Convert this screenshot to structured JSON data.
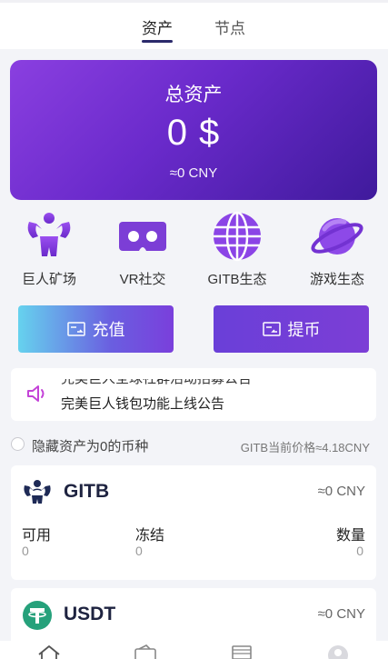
{
  "tabs": [
    {
      "label": "资产",
      "active": true
    },
    {
      "label": "节点",
      "active": false
    }
  ],
  "hero": {
    "title": "总资产",
    "amount": "0 $",
    "cny": "≈0 CNY"
  },
  "features": [
    {
      "label": "巨人矿场",
      "icon": "muscle-giant-icon"
    },
    {
      "label": "VR社交",
      "icon": "vr-headset-icon"
    },
    {
      "label": "GITB生态",
      "icon": "globe-icon"
    },
    {
      "label": "游戏生态",
      "icon": "planet-icon"
    }
  ],
  "actions": {
    "deposit": "充值",
    "withdraw": "提币"
  },
  "notice": {
    "previous": "完美巨人全球社群活动招募公告",
    "current": "完美巨人钱包功能上线公告"
  },
  "filter": {
    "hide_zero_label": "隐藏资产为0的币种",
    "price_text": "GITB当前价格≈4.18CNY"
  },
  "assets": [
    {
      "name": "GITB",
      "cny": "≈0 CNY",
      "columns": [
        {
          "label": "可用",
          "value": "0"
        },
        {
          "label": "冻结",
          "value": "0"
        },
        {
          "label": "数量",
          "value": "0"
        }
      ]
    },
    {
      "name": "USDT",
      "cny": "≈0 CNY"
    }
  ],
  "bottom_nav": [
    "home-icon",
    "wallet-icon",
    "laptop-icon",
    "user-icon"
  ],
  "colors": {
    "accent": "#6a2acb",
    "navy": "#2b2a6b",
    "usdt": "#26a17b"
  }
}
